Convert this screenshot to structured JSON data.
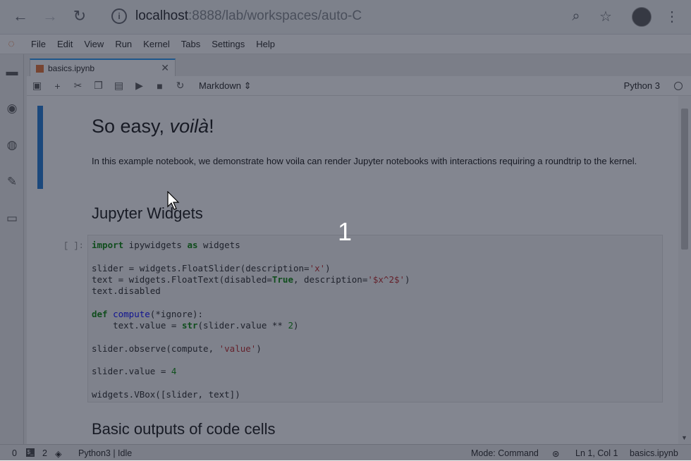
{
  "browser": {
    "url_host": "localhost",
    "url_path": ":8888/lab/workspaces/auto-C"
  },
  "menu": {
    "items": [
      "File",
      "Edit",
      "View",
      "Run",
      "Kernel",
      "Tabs",
      "Settings",
      "Help"
    ]
  },
  "notebook_tab": {
    "title": "basics.ipynb"
  },
  "toolbar": {
    "cell_type": "Markdown",
    "kernel_name": "Python 3"
  },
  "cells": {
    "heading_plain": "So easy, ",
    "heading_italic": "voilà",
    "heading_end": "!",
    "paragraph": "In this example notebook, we demonstrate how voila can render Jupyter notebooks with interactions requiring a roundtrip to the kernel.",
    "section_widgets": "Jupyter Widgets",
    "prompt": "[ ]:",
    "section_outputs": "Basic outputs of code cells"
  },
  "status": {
    "terminals": "0",
    "kernels": "2",
    "kernel_status": "Python3 | Idle",
    "mode": "Mode: Command",
    "position": "Ln 1, Col 1",
    "file": "basics.ipynb"
  },
  "overlay": {
    "step_number": "1"
  },
  "colors": {
    "accent": "#2196f3",
    "overlay": "#1e2234"
  }
}
